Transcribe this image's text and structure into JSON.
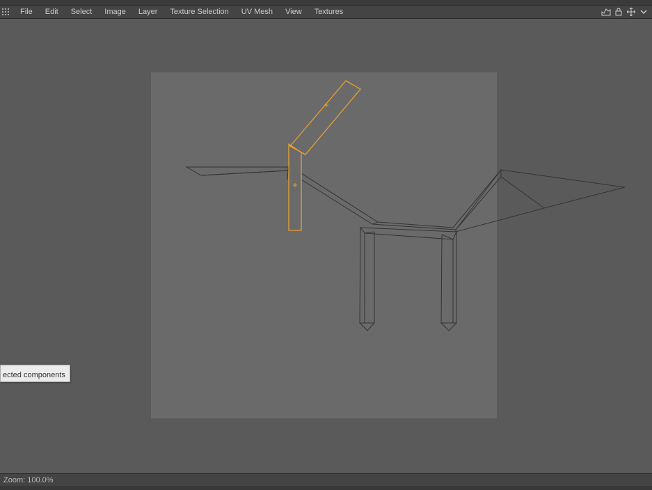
{
  "menubar": {
    "items": [
      "File",
      "Edit",
      "Select",
      "Image",
      "Layer",
      "Texture Selection",
      "UV Mesh",
      "View",
      "Textures"
    ]
  },
  "tooltip": {
    "text": "ected components"
  },
  "statusbar": {
    "zoom_label": "Zoom:",
    "zoom_value": "100.0%"
  }
}
